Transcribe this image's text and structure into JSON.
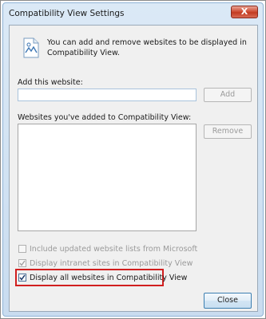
{
  "window": {
    "title": "Compatibility View Settings",
    "close_glyph": "X"
  },
  "info": {
    "icon": "globe-document-icon",
    "text": "You can add and remove websites to be displayed in Compatibility View."
  },
  "add_site": {
    "label": "Add this website:",
    "value": "",
    "button_label": "Add"
  },
  "site_list": {
    "label": "Websites you've added to Compatibility View:",
    "items": [],
    "remove_label": "Remove"
  },
  "options": [
    {
      "label": "Include updated website lists from Microsoft",
      "checked": false,
      "enabled": false
    },
    {
      "label": "Display intranet sites in Compatibility View",
      "checked": true,
      "enabled": false
    },
    {
      "label": "Display all websites in Compatibility View",
      "checked": true,
      "enabled": true
    }
  ],
  "footer": {
    "close_label": "Close"
  },
  "colors": {
    "highlight": "#d11f1f",
    "title_bar": "#c9dcef",
    "close_button": "#c23b22"
  }
}
